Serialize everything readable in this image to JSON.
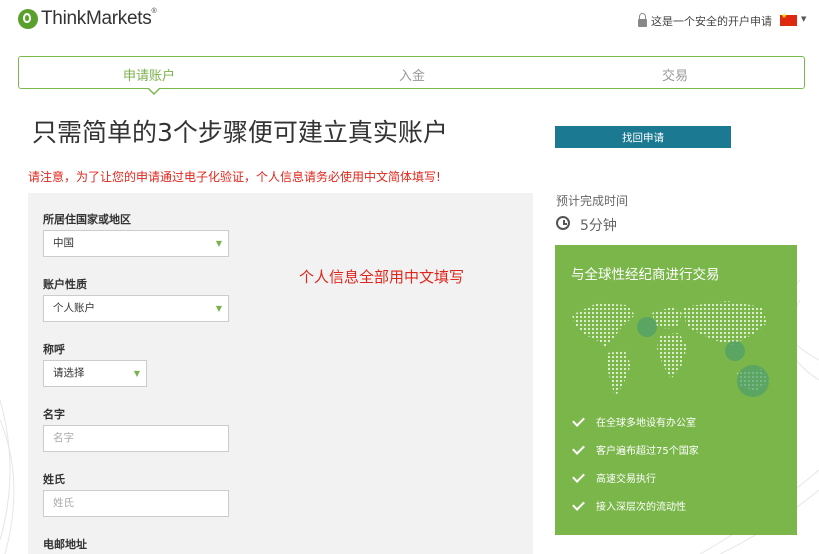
{
  "header": {
    "brand": "ThinkMarkets",
    "trademark": "®",
    "secure_text": "这是一个安全的开户申请"
  },
  "steps": [
    {
      "label": "申请账户",
      "active": true
    },
    {
      "label": "入金",
      "active": false
    },
    {
      "label": "交易",
      "active": false
    }
  ],
  "page_title": "只需简单的3个步骤便可建立真实账户",
  "notice": "请注意，为了让您的申请通过电子化验证，个人信息请务必使用中文简体填写!",
  "annotation": "个人信息全部用中文填写",
  "retrieve_button": "找回申请",
  "form": {
    "country": {
      "label": "所居住国家或地区",
      "value": "中国"
    },
    "account_type": {
      "label": "账户性质",
      "value": "个人账户"
    },
    "salutation": {
      "label": "称呼",
      "value": "请选择"
    },
    "first_name": {
      "label": "名字",
      "placeholder": "名字"
    },
    "last_name": {
      "label": "姓氏",
      "placeholder": "姓氏"
    },
    "email": {
      "label": "电邮地址"
    }
  },
  "sidebar": {
    "eta_label": "预计完成时间",
    "eta_value": "5分钟",
    "promo_title": "与全球性经纪商进行交易",
    "features": [
      "在全球多地设有办公室",
      "客户遍布超过75个国家",
      "高速交易执行",
      "接入深层次的流动性"
    ]
  },
  "colors": {
    "brand_green": "#7ab649",
    "accent_teal": "#1b7a92",
    "notice_red": "#e0261c"
  }
}
